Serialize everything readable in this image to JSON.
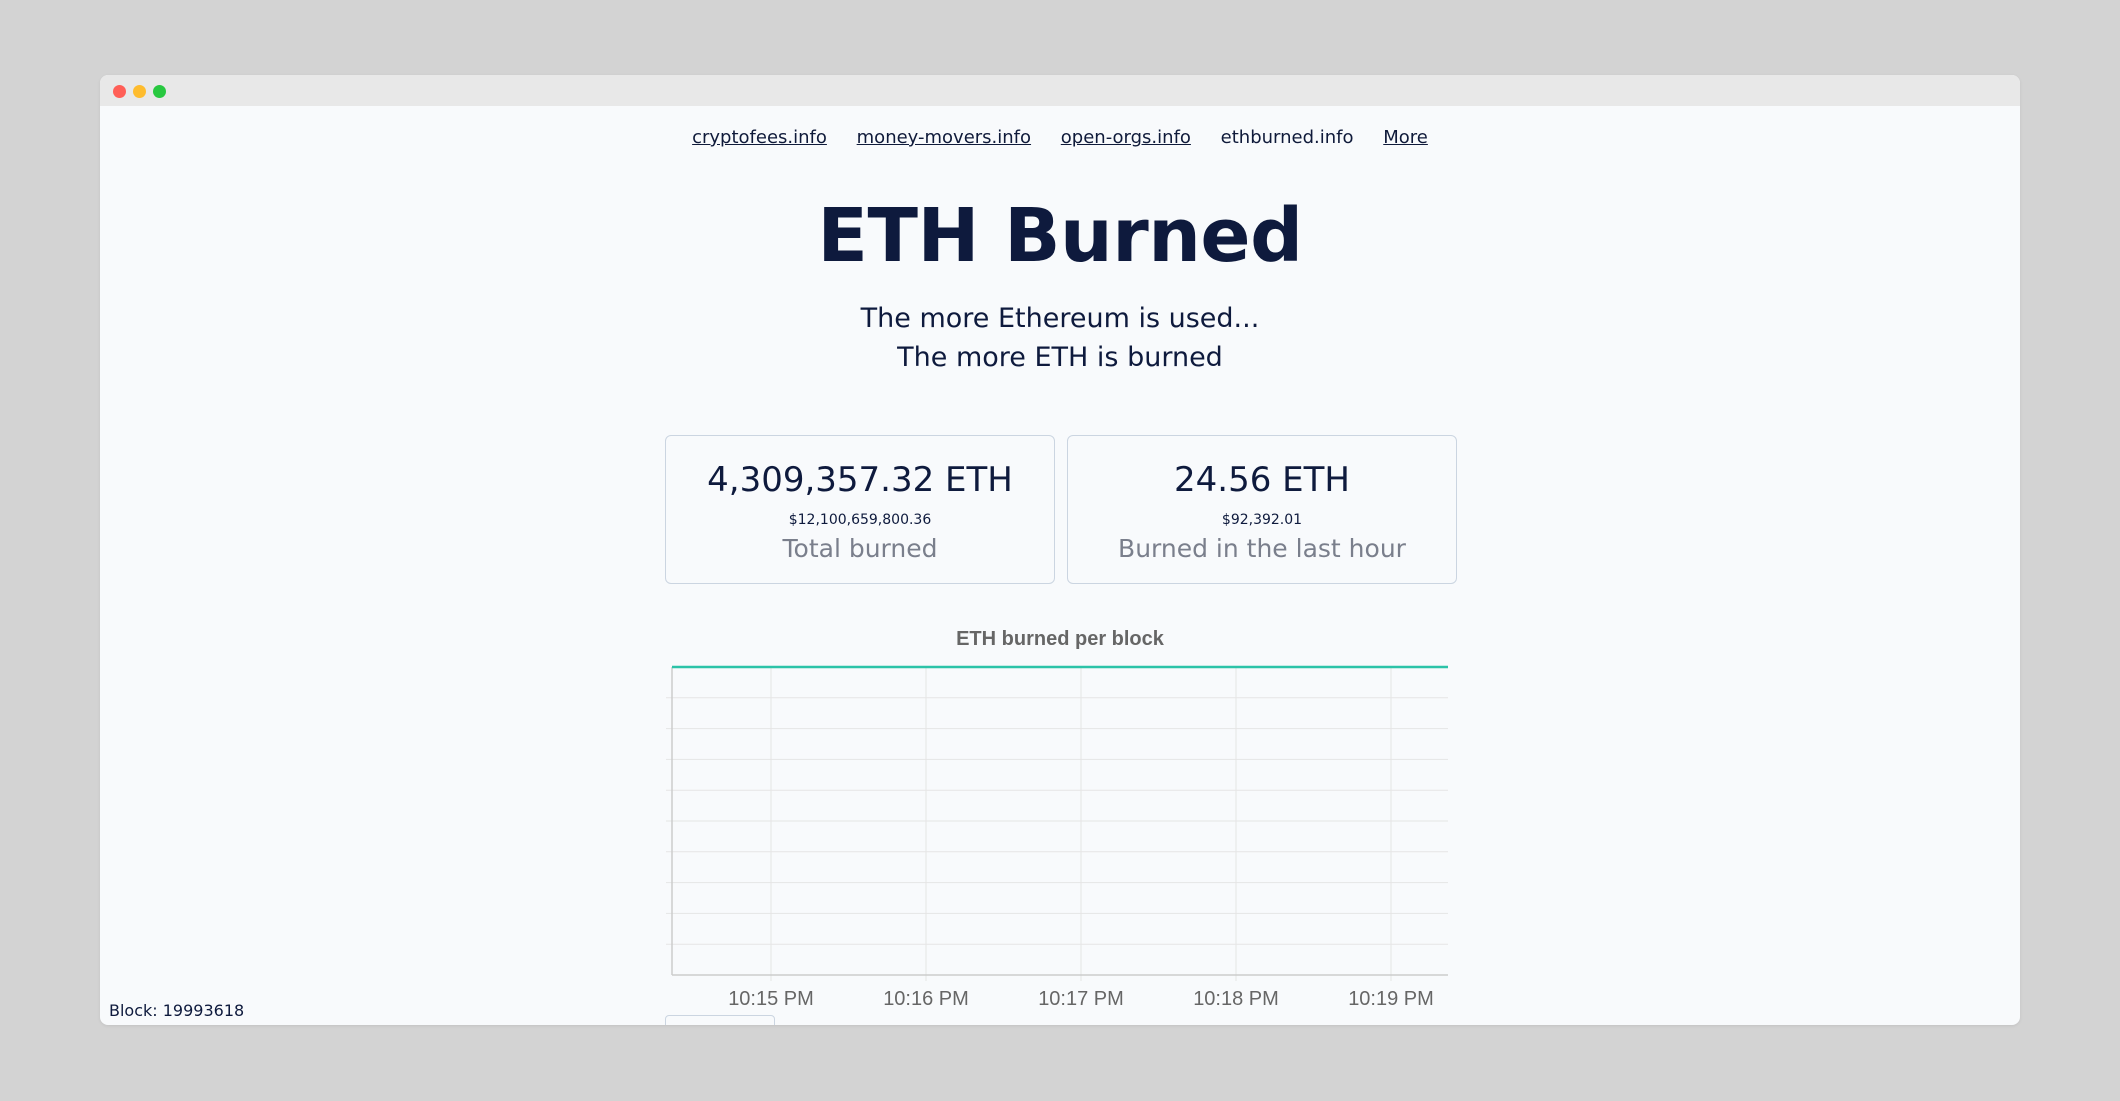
{
  "nav": {
    "links": [
      "cryptofees.info",
      "money-movers.info",
      "open-orgs.info",
      "ethburned.info",
      "More"
    ]
  },
  "page": {
    "title": "ETH Burned",
    "subtitle_line1": "The more Ethereum is used...",
    "subtitle_line2": "The more ETH is burned"
  },
  "cards": {
    "total": {
      "value": "4,309,357.32 ETH",
      "usd": "$12,100,659,800.36",
      "label": "Total burned"
    },
    "hour": {
      "value": "24.56 ETH",
      "usd": "$92,392.01",
      "label": "Burned in the last hour"
    }
  },
  "chart_data": {
    "type": "line",
    "title": "ETH burned per block",
    "x_tick_labels": [
      "10:15 PM",
      "10:16 PM",
      "10:17 PM",
      "10:18 PM",
      "10:19 PM"
    ],
    "series": [],
    "grid": true
  },
  "footer": {
    "block": "Block: 19993618"
  },
  "colors": {
    "series_line": "#2cc3a8",
    "grid": "#e5e5e5",
    "text_dark": "#0e1a3d",
    "text_muted": "#7a7f8c"
  }
}
